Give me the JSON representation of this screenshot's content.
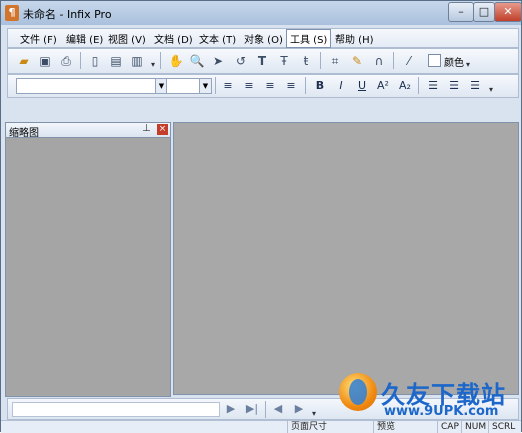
{
  "window": {
    "title": "未命名 - Infix Pro"
  },
  "menu": [
    {
      "label": "文件 (F)",
      "name": "menu-file"
    },
    {
      "label": "编辑 (E)",
      "name": "menu-edit"
    },
    {
      "label": "视图 (V)",
      "name": "menu-view"
    },
    {
      "label": "文档 (D)",
      "name": "menu-document"
    },
    {
      "label": "文本 (T)",
      "name": "menu-text"
    },
    {
      "label": "对象 (O)",
      "name": "menu-object"
    },
    {
      "label": "工具 (S)",
      "name": "menu-tools",
      "active": true
    },
    {
      "label": "帮助 (H)",
      "name": "menu-help"
    }
  ],
  "toolbar": {
    "color_label": "颜色",
    "font_name": "",
    "font_size": ""
  },
  "thumbnail_panel": {
    "title": "缩略图"
  },
  "navigation": {
    "page_value": ""
  },
  "status": {
    "page_size": "页面尺寸",
    "preview": "预览",
    "cap": "CAP",
    "num": "NUM",
    "scrl": "SCRL"
  },
  "watermark": {
    "title": "久友下载站",
    "url": "www.9UPK.com"
  },
  "colors": {
    "window_bg": "#d9e3f0",
    "canvas": "#a8a8a8",
    "accent": "#1c67c9"
  }
}
